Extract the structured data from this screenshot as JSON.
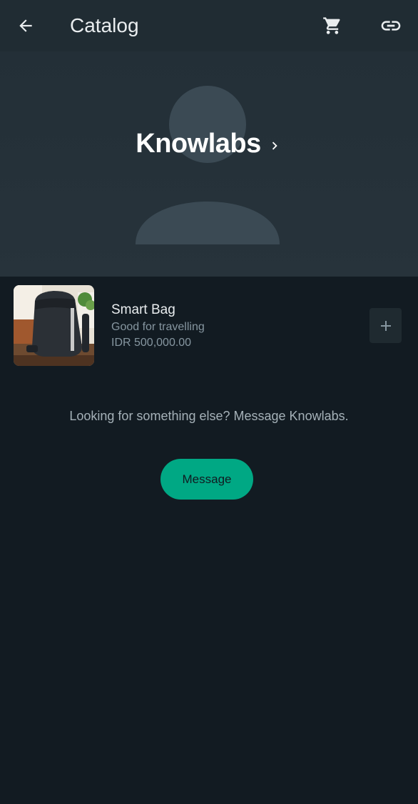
{
  "header": {
    "title": "Catalog",
    "icons": {
      "back": "arrow-left-icon",
      "cart": "shopping-cart-icon",
      "link": "link-icon"
    }
  },
  "banner": {
    "business_name": "Knowlabs",
    "chevron": "chevron-right-icon",
    "avatar": "default-avatar-placeholder"
  },
  "products": [
    {
      "name": "Smart Bag",
      "description": "Good for travelling",
      "price": "IDR 500,000.00",
      "add_icon": "plus-icon"
    }
  ],
  "footer": {
    "prompt": "Looking for something else? Message Knowlabs.",
    "message_button": "Message"
  },
  "colors": {
    "background": "#121b22",
    "header": "#202c33",
    "banner": "#27333b",
    "accent": "#00a884",
    "primary_text": "#e9edef",
    "secondary_text": "#8696a0"
  }
}
